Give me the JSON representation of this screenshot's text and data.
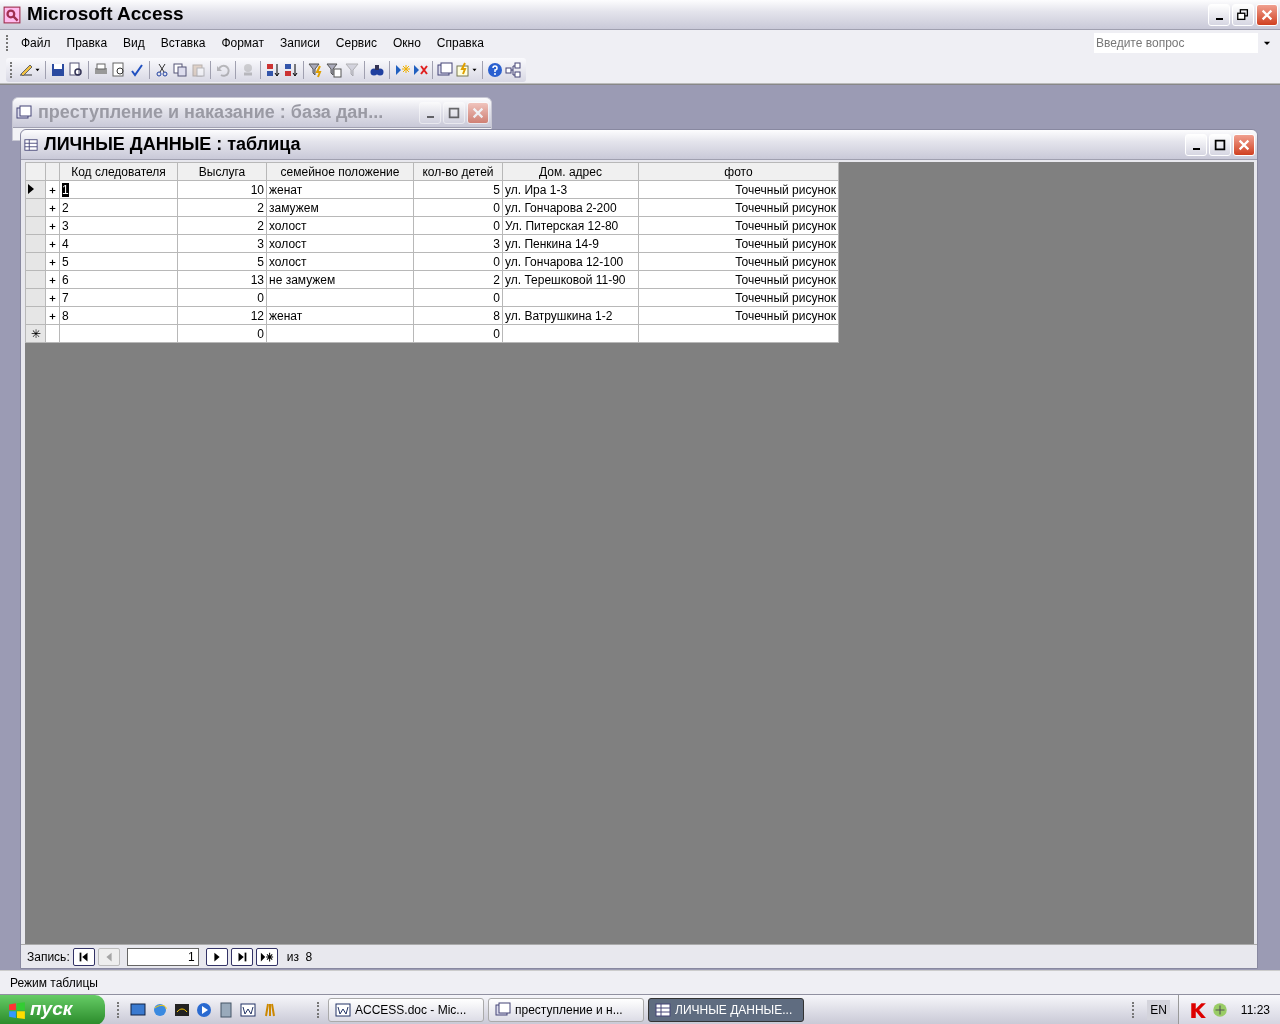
{
  "app_window": {
    "title": "Microsoft Access"
  },
  "menu": [
    "Файл",
    "Правка",
    "Вид",
    "Вставка",
    "Формат",
    "Записи",
    "Сервис",
    "Окно",
    "Справка"
  ],
  "help_search": {
    "placeholder": "Введите вопрос"
  },
  "toolbar": [
    {
      "kind": "design",
      "disabled": false
    },
    {
      "kind": "separator"
    },
    {
      "kind": "save",
      "disabled": false
    },
    {
      "kind": "search-file",
      "disabled": false
    },
    {
      "kind": "separator"
    },
    {
      "kind": "print",
      "disabled": false
    },
    {
      "kind": "preview",
      "disabled": false
    },
    {
      "kind": "spelling",
      "disabled": false
    },
    {
      "kind": "separator"
    },
    {
      "kind": "cut",
      "disabled": false
    },
    {
      "kind": "copy",
      "disabled": false
    },
    {
      "kind": "paste",
      "disabled": true
    },
    {
      "kind": "separator"
    },
    {
      "kind": "undo",
      "disabled": true
    },
    {
      "kind": "separator"
    },
    {
      "kind": "link",
      "disabled": true
    },
    {
      "kind": "separator"
    },
    {
      "kind": "sort-asc",
      "disabled": false
    },
    {
      "kind": "sort-desc",
      "disabled": false
    },
    {
      "kind": "separator"
    },
    {
      "kind": "filter-lightning",
      "disabled": false
    },
    {
      "kind": "filter-form",
      "disabled": false
    },
    {
      "kind": "filter",
      "disabled": true
    },
    {
      "kind": "separator"
    },
    {
      "kind": "find",
      "disabled": false
    },
    {
      "kind": "separator"
    },
    {
      "kind": "new-record",
      "disabled": false
    },
    {
      "kind": "delete-record",
      "disabled": false
    },
    {
      "kind": "separator"
    },
    {
      "kind": "db-window",
      "disabled": false
    },
    {
      "kind": "new-object",
      "disabled": false
    },
    {
      "kind": "separator"
    },
    {
      "kind": "help",
      "disabled": false
    },
    {
      "kind": "relations",
      "disabled": false
    }
  ],
  "background_window": {
    "title": "преступление и наказание : база дан..."
  },
  "table_window": {
    "title": "ЛИЧНЫЕ ДАННЫЕ : таблица",
    "columns": [
      "Код следователя",
      "Выслуга",
      "семейное положение",
      "кол-во детей",
      "Дом. адрес",
      "фото"
    ],
    "rows": [
      {
        "selected": true,
        "cells": [
          "1",
          "10",
          "женат",
          "5",
          "ул. Ира 1-3",
          "Точечный рисунок"
        ]
      },
      {
        "selected": false,
        "cells": [
          "2",
          "2",
          "замужем",
          "0",
          "ул. Гончарова 2-200",
          "Точечный рисунок"
        ]
      },
      {
        "selected": false,
        "cells": [
          "3",
          "2",
          "холост",
          "0",
          "Ул. Питерская 12-80",
          "Точечный рисунок"
        ]
      },
      {
        "selected": false,
        "cells": [
          "4",
          "3",
          "холост",
          "3",
          "ул. Пенкина 14-9",
          "Точечный рисунок"
        ]
      },
      {
        "selected": false,
        "cells": [
          "5",
          "5",
          "холост",
          "0",
          "ул. Гончарова 12-100",
          "Точечный рисунок"
        ]
      },
      {
        "selected": false,
        "cells": [
          "6",
          "13",
          "не замужем",
          "2",
          "ул. Терешковой 11-90",
          "Точечный рисунок"
        ]
      },
      {
        "selected": false,
        "cells": [
          "7",
          "0",
          null,
          "0",
          null,
          "Точечный рисунок"
        ]
      },
      {
        "selected": false,
        "cells": [
          "8",
          "12",
          "женат",
          "8",
          "ул. Ватрушкина 1-2",
          "Точечный рисунок"
        ]
      }
    ],
    "new_row": {
      "marker": "✳",
      "cells": [
        null,
        "0",
        null,
        "0",
        null,
        null
      ]
    },
    "navigator": {
      "label": "Запись:",
      "buttons": [
        {
          "kind": "first",
          "disabled": false
        },
        {
          "kind": "prev",
          "disabled": true
        },
        {
          "kind": "field",
          "value": "1"
        },
        {
          "kind": "next",
          "disabled": false
        },
        {
          "kind": "last",
          "disabled": false
        },
        {
          "kind": "new",
          "disabled": false
        }
      ],
      "total": "из  8"
    }
  },
  "status_bar": "Режим таблицы",
  "taskbar": {
    "start": "пуск",
    "tasks": [
      {
        "kind": "word",
        "label": "ACCESS.doc - Mic...",
        "selected": false
      },
      {
        "kind": "database",
        "label": "преступление и н...",
        "selected": false
      },
      {
        "kind": "table",
        "label": "ЛИЧНЫЕ ДАННЫЕ...",
        "selected": true
      }
    ],
    "language": "EN",
    "clock": "11:23"
  }
}
